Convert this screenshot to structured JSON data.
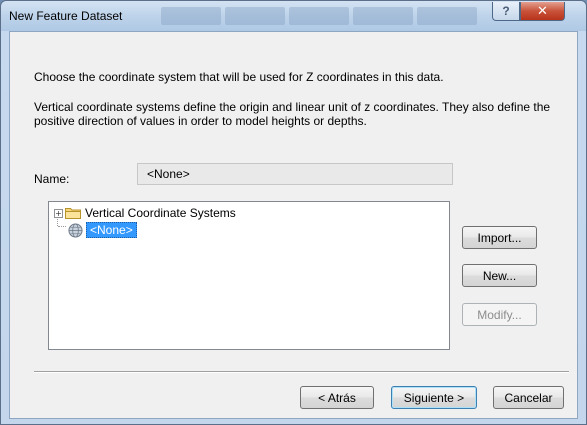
{
  "window": {
    "title": "New Feature Dataset",
    "help_glyph": "?",
    "close_glyph": "✕"
  },
  "content": {
    "intro": "Choose the coordinate system that will be used for Z coordinates in this data.",
    "description": "Vertical coordinate systems define the origin and linear unit of z coordinates. They also define the positive direction of values in order to model heights or depths.",
    "name_label": "Name:",
    "name_value": "<None>"
  },
  "tree": {
    "items": [
      {
        "label": "Vertical Coordinate Systems",
        "icon": "folder-icon",
        "expander": "+"
      },
      {
        "label": "<None>",
        "icon": "globe-icon",
        "selected": true
      }
    ]
  },
  "side_buttons": {
    "import": "Import...",
    "new": "New...",
    "modify": "Modify..."
  },
  "footer": {
    "back": "< Atrás",
    "next": "Siguiente >",
    "cancel": "Cancelar"
  },
  "colors": {
    "selection": "#3399ff",
    "close_button": "#c8533a",
    "title_bar": "#bdd3ea"
  }
}
